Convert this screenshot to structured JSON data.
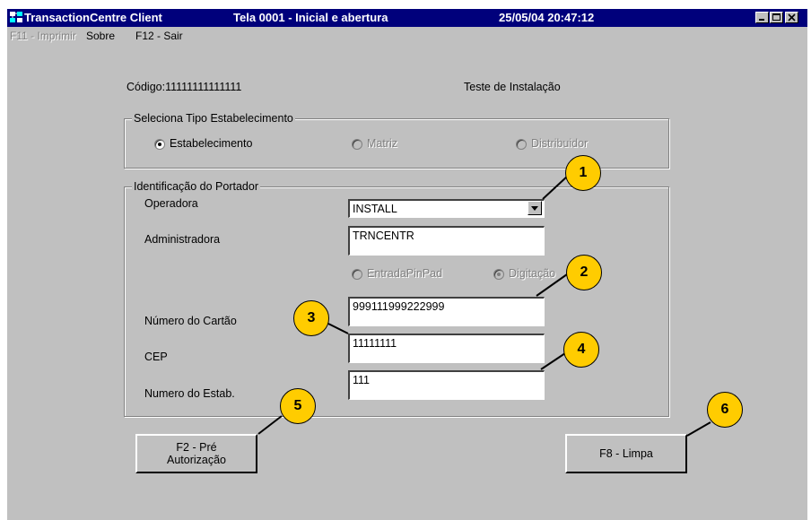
{
  "window": {
    "title_app": "TransactionCentre Client",
    "title_screen": "Tela 0001 - Inicial e abertura",
    "title_datetime": "25/05/04 20:47:12",
    "controls": [
      "minimize-icon",
      "maximize-icon",
      "close-icon"
    ]
  },
  "menu": {
    "print": "F11 - Imprimir",
    "about": "Sobre",
    "exit": "F12 - Sair"
  },
  "header": {
    "code": "Código:11111111111111",
    "mode": "Teste de Instalação"
  },
  "tipo": {
    "legend": "Seleciona Tipo Estabelecimento",
    "options": [
      {
        "label": "Estabelecimento",
        "selected": true,
        "enabled": true
      },
      {
        "label": "Matriz",
        "selected": false,
        "enabled": false
      },
      {
        "label": "Distribuidor",
        "selected": false,
        "enabled": false
      }
    ]
  },
  "portador": {
    "legend": "Identificação do Portador",
    "operadora_label": "Operadora",
    "operadora_value": "INSTALL",
    "administradora_label": "Administradora",
    "administradora_value": "TRNCENTR",
    "entry_options": [
      {
        "label": "EntradaPinPad",
        "selected": false,
        "enabled": false
      },
      {
        "label": "Digitação",
        "selected": true,
        "enabled": false
      }
    ],
    "cartao_label": "Número do Cartão",
    "cartao_value": "999111999222999",
    "cep_label": "CEP",
    "cep_value": "11111111",
    "estab_label": "Numero do Estab.",
    "estab_value": "111"
  },
  "buttons": {
    "preauth_line1": "F2 - Pré",
    "preauth_line2": "Autorização",
    "clear": "F8 - Limpa"
  },
  "callouts": [
    "1",
    "2",
    "3",
    "4",
    "5",
    "6"
  ],
  "colors": {
    "titlebar": "#00007b",
    "window_bg": "#c0c0c0",
    "callout_fill": "#ffcc00"
  }
}
